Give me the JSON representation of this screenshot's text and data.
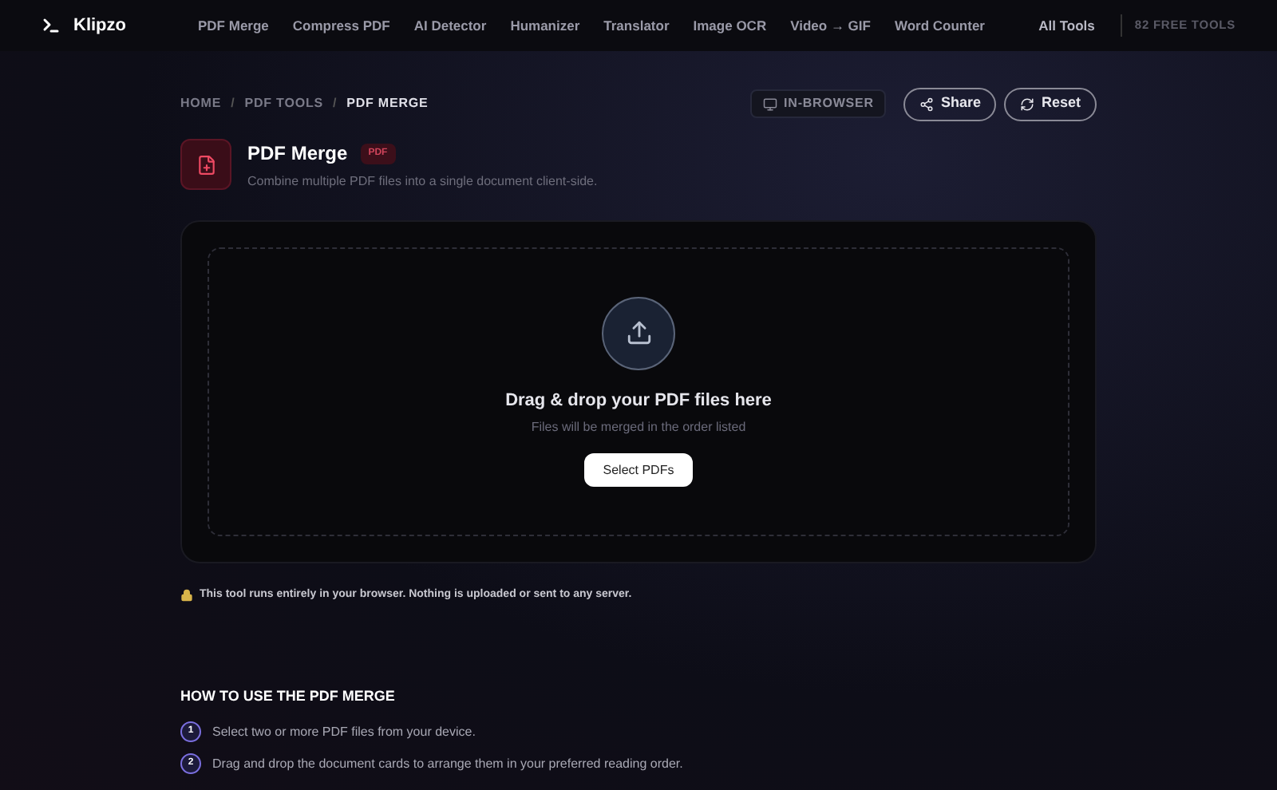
{
  "header": {
    "logo": "Klipzo",
    "nav": [
      "PDF Merge",
      "Compress PDF",
      "AI Detector",
      "Humanizer",
      "Translator",
      "Image OCR",
      "Video → GIF",
      "Word Counter"
    ],
    "all_tools": "All Tools",
    "count": "82 FREE TOOLS"
  },
  "breadcrumb": {
    "items": [
      "HOME",
      "PDF TOOLS",
      "PDF MERGE"
    ],
    "separator": "/"
  },
  "badge": "IN-BROWSER",
  "actions": [
    {
      "kind": "share",
      "label": "Share"
    },
    {
      "kind": "reset",
      "label": "Reset"
    }
  ],
  "tool": {
    "title": "PDF Merge",
    "tag": "PDF",
    "description": "Combine multiple PDF files into a single document client-side."
  },
  "dropzone": {
    "title": "Drag & drop your PDF files here",
    "subtitle": "Files will be merged in the order listed",
    "button": "Select PDFs"
  },
  "privacy_note": "This tool runs entirely in your browser. Nothing is uploaded or sent to any server.",
  "how_to": {
    "heading": "HOW TO USE THE PDF MERGE",
    "steps": [
      {
        "number": "1",
        "text": "Select two or more PDF files from your device."
      },
      {
        "number": "2",
        "text": "Drag and drop the document cards to arrange them in your preferred reading order."
      }
    ]
  }
}
